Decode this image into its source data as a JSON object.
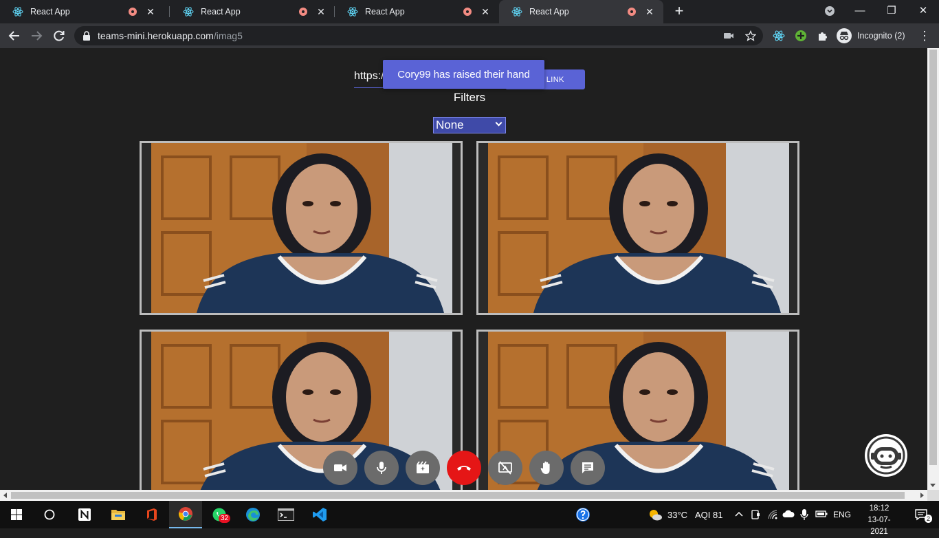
{
  "browser": {
    "tabs": [
      {
        "title": "React App",
        "active": false
      },
      {
        "title": "React App",
        "active": false
      },
      {
        "title": "React App",
        "active": false
      },
      {
        "title": "React App",
        "active": true
      }
    ],
    "url_host": "teams-mini.herokuapp.com",
    "url_path": "/imag5",
    "profile_label": "Incognito (2)"
  },
  "page": {
    "invite_text": "https:/",
    "invite_button": "VITE LINK",
    "toast": "Cory99 has raised their hand",
    "filters_label": "Filters",
    "filter_selected": "None"
  },
  "controls": [
    {
      "name": "camera-button",
      "icon": "videocam-icon"
    },
    {
      "name": "mic-button",
      "icon": "mic-icon"
    },
    {
      "name": "record-button",
      "icon": "record-icon"
    },
    {
      "name": "end-call-button",
      "icon": "end-call-icon"
    },
    {
      "name": "screen-share-button",
      "icon": "screen-share-off-icon"
    },
    {
      "name": "raise-hand-button",
      "icon": "hand-icon"
    },
    {
      "name": "chat-button",
      "icon": "chat-icon"
    }
  ],
  "taskbar": {
    "whatsapp_badge": "32",
    "weather": "33°C",
    "aqi": "AQI 81",
    "language": "ENG",
    "time": "18:12",
    "date": "13-07-2021",
    "notification_count": "2"
  },
  "colors": {
    "accent": "#5a63d6",
    "end_call": "#e51616",
    "page_bg": "#1f1f1f"
  }
}
